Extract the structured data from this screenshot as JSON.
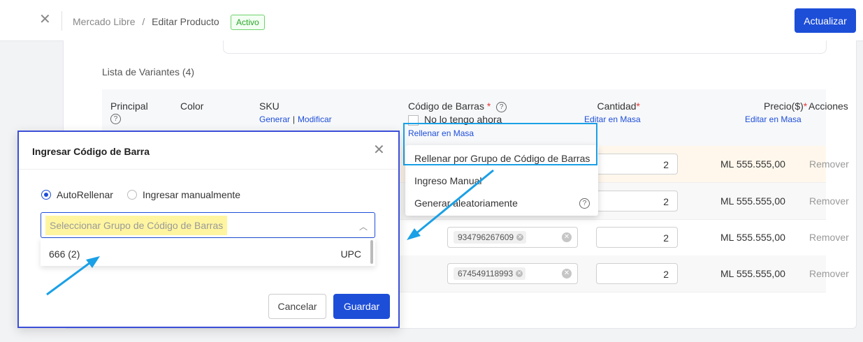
{
  "header": {
    "close_icon": "close-icon",
    "breadcrumb_root": "Mercado Libre",
    "breadcrumb_sep": "/",
    "breadcrumb_current": "Editar Producto",
    "status_badge": "Activo",
    "update_button": "Actualizar"
  },
  "variants": {
    "title": "Lista de Variantes (4)",
    "columns": {
      "principal": "Principal",
      "color": "Color",
      "sku": "SKU",
      "sku_generate": "Generar",
      "sku_sep": "|",
      "sku_modify": "Modificar",
      "barcode": "Código de Barras",
      "barcode_required": "*",
      "no_barcode": "No lo tengo ahora",
      "bulk_fill": "Rellenar en Masa",
      "quantity": "Cantidad",
      "quantity_required": "*",
      "quantity_bulk": "Editar en Masa",
      "price": "Precio($)",
      "price_required": "*",
      "price_bulk": "Editar en Masa",
      "actions": "Acciones"
    },
    "rows": [
      {
        "barcode": "",
        "quantity": "2",
        "price": "ML 555.555,00",
        "action": "Remover"
      },
      {
        "barcode": "",
        "quantity": "2",
        "price": "ML 555.555,00",
        "action": "Remover"
      },
      {
        "barcode": "934796267609",
        "quantity": "2",
        "price": "ML 555.555,00",
        "action": "Remover"
      },
      {
        "barcode": "674549118993",
        "quantity": "2",
        "price": "ML 555.555,00",
        "action": "Remover"
      }
    ]
  },
  "bulk_menu": {
    "items": [
      "Rellenar por Grupo de Código de Barras",
      "Ingreso Manual",
      "Generar aleatoriamente"
    ]
  },
  "modal": {
    "title": "Ingresar Código de Barra",
    "radio_auto": "AutoRellenar",
    "radio_manual": "Ingresar manualmente",
    "select_placeholder": "Seleccionar Grupo de Código de Barras",
    "option_name": "666 (2)",
    "option_type": "UPC",
    "cancel": "Cancelar",
    "save": "Guardar"
  },
  "colors": {
    "primary": "#1d4ed8",
    "annotation": "#1aa0e6",
    "modal_border": "#3b4fd8",
    "highlight": "#fff5a0",
    "row_highlight": "#fff7ec"
  }
}
